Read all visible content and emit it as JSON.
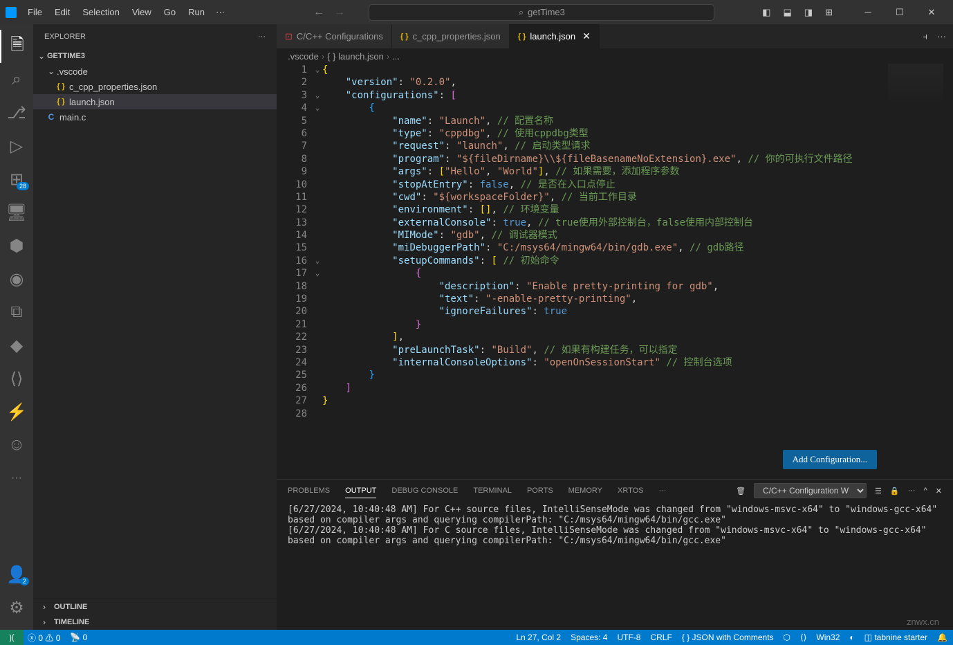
{
  "titlebar": {
    "menus": [
      "File",
      "Edit",
      "Selection",
      "View",
      "Go",
      "Run"
    ],
    "search_placeholder": "getTime3"
  },
  "sidebar": {
    "title": "EXPLORER",
    "project": "GETTIME3",
    "tree": [
      {
        "label": ".vscode",
        "type": "folder",
        "indent": 1
      },
      {
        "label": "c_cpp_properties.json",
        "type": "json",
        "indent": 2
      },
      {
        "label": "launch.json",
        "type": "json",
        "indent": 2,
        "selected": true
      },
      {
        "label": "main.c",
        "type": "c",
        "indent": 1
      }
    ],
    "outline": "OUTLINE",
    "timeline": "TIMELINE"
  },
  "tabs": [
    {
      "label": "C/C++ Configurations",
      "icon": "cpp"
    },
    {
      "label": "c_cpp_properties.json",
      "icon": "json"
    },
    {
      "label": "launch.json",
      "icon": "json",
      "active": true,
      "closable": true
    }
  ],
  "breadcrumb": [
    ".vscode",
    "launch.json",
    "..."
  ],
  "editor": {
    "lines": [
      {
        "n": 1,
        "fold": "v",
        "t": [
          [
            "{",
            "brace"
          ]
        ]
      },
      {
        "n": 2,
        "t": [
          [
            "    ",
            "p"
          ],
          [
            "\"version\"",
            "key"
          ],
          [
            ": ",
            "p"
          ],
          [
            "\"0.2.0\"",
            "str"
          ],
          [
            ",",
            "p"
          ]
        ]
      },
      {
        "n": 3,
        "fold": "v",
        "t": [
          [
            "    ",
            "p"
          ],
          [
            "\"configurations\"",
            "key"
          ],
          [
            ": ",
            "p"
          ],
          [
            "[",
            "brace2"
          ]
        ]
      },
      {
        "n": 4,
        "fold": "v",
        "t": [
          [
            "        ",
            "p"
          ],
          [
            "{",
            "brace3"
          ]
        ]
      },
      {
        "n": 5,
        "t": [
          [
            "            ",
            "p"
          ],
          [
            "\"name\"",
            "key"
          ],
          [
            ": ",
            "p"
          ],
          [
            "\"Launch\"",
            "str"
          ],
          [
            ", ",
            "p"
          ],
          [
            "// 配置名称",
            "comment"
          ]
        ]
      },
      {
        "n": 6,
        "t": [
          [
            "            ",
            "p"
          ],
          [
            "\"type\"",
            "key"
          ],
          [
            ": ",
            "p"
          ],
          [
            "\"cppdbg\"",
            "str"
          ],
          [
            ", ",
            "p"
          ],
          [
            "// 使用cppdbg类型",
            "comment"
          ]
        ]
      },
      {
        "n": 7,
        "t": [
          [
            "            ",
            "p"
          ],
          [
            "\"request\"",
            "key"
          ],
          [
            ": ",
            "p"
          ],
          [
            "\"launch\"",
            "str"
          ],
          [
            ", ",
            "p"
          ],
          [
            "// 启动类型请求",
            "comment"
          ]
        ]
      },
      {
        "n": 8,
        "t": [
          [
            "            ",
            "p"
          ],
          [
            "\"program\"",
            "key"
          ],
          [
            ": ",
            "p"
          ],
          [
            "\"${fileDirname}\\\\${fileBasenameNoExtension}.exe\"",
            "str"
          ],
          [
            ", ",
            "p"
          ],
          [
            "// 你的可执行文件路径",
            "comment"
          ]
        ]
      },
      {
        "n": 9,
        "t": [
          [
            "            ",
            "p"
          ],
          [
            "\"args\"",
            "key"
          ],
          [
            ": ",
            "p"
          ],
          [
            "[",
            "brace"
          ],
          [
            "\"Hello\"",
            "str"
          ],
          [
            ", ",
            "p"
          ],
          [
            "\"World\"",
            "str"
          ],
          [
            "]",
            "brace"
          ],
          [
            ", ",
            "p"
          ],
          [
            "// 如果需要，添加程序参数",
            "comment"
          ]
        ]
      },
      {
        "n": 10,
        "t": [
          [
            "            ",
            "p"
          ],
          [
            "\"stopAtEntry\"",
            "key"
          ],
          [
            ": ",
            "p"
          ],
          [
            "false",
            "bool"
          ],
          [
            ", ",
            "p"
          ],
          [
            "// 是否在入口点停止",
            "comment"
          ]
        ]
      },
      {
        "n": 11,
        "t": [
          [
            "            ",
            "p"
          ],
          [
            "\"cwd\"",
            "key"
          ],
          [
            ": ",
            "p"
          ],
          [
            "\"${workspaceFolder}\"",
            "str"
          ],
          [
            ", ",
            "p"
          ],
          [
            "// 当前工作目录",
            "comment"
          ]
        ]
      },
      {
        "n": 12,
        "t": [
          [
            "            ",
            "p"
          ],
          [
            "\"environment\"",
            "key"
          ],
          [
            ": ",
            "p"
          ],
          [
            "[]",
            "brace"
          ],
          [
            ", ",
            "p"
          ],
          [
            "// 环境变量",
            "comment"
          ]
        ]
      },
      {
        "n": 13,
        "t": [
          [
            "            ",
            "p"
          ],
          [
            "\"externalConsole\"",
            "key"
          ],
          [
            ": ",
            "p"
          ],
          [
            "true",
            "bool"
          ],
          [
            ", ",
            "p"
          ],
          [
            "// true使用外部控制台，false使用内部控制台",
            "comment"
          ]
        ]
      },
      {
        "n": 14,
        "t": [
          [
            "            ",
            "p"
          ],
          [
            "\"MIMode\"",
            "key"
          ],
          [
            ": ",
            "p"
          ],
          [
            "\"gdb\"",
            "str"
          ],
          [
            ", ",
            "p"
          ],
          [
            "// 调试器模式",
            "comment"
          ]
        ]
      },
      {
        "n": 15,
        "t": [
          [
            "            ",
            "p"
          ],
          [
            "\"miDebuggerPath\"",
            "key"
          ],
          [
            ": ",
            "p"
          ],
          [
            "\"C:/msys64/mingw64/bin/gdb.exe\"",
            "str"
          ],
          [
            ", ",
            "p"
          ],
          [
            "// gdb路径",
            "comment"
          ]
        ]
      },
      {
        "n": 16,
        "fold": "v",
        "t": [
          [
            "            ",
            "p"
          ],
          [
            "\"setupCommands\"",
            "key"
          ],
          [
            ": ",
            "p"
          ],
          [
            "[ ",
            "brace"
          ],
          [
            "// 初始命令",
            "comment"
          ]
        ]
      },
      {
        "n": 17,
        "fold": "v",
        "t": [
          [
            "                ",
            "p"
          ],
          [
            "{",
            "brace2"
          ]
        ]
      },
      {
        "n": 18,
        "t": [
          [
            "                    ",
            "p"
          ],
          [
            "\"description\"",
            "key"
          ],
          [
            ": ",
            "p"
          ],
          [
            "\"Enable pretty-printing for gdb\"",
            "str"
          ],
          [
            ",",
            "p"
          ]
        ]
      },
      {
        "n": 19,
        "t": [
          [
            "                    ",
            "p"
          ],
          [
            "\"text\"",
            "key"
          ],
          [
            ": ",
            "p"
          ],
          [
            "\"-enable-pretty-printing\"",
            "str"
          ],
          [
            ",",
            "p"
          ]
        ]
      },
      {
        "n": 20,
        "t": [
          [
            "                    ",
            "p"
          ],
          [
            "\"ignoreFailures\"",
            "key"
          ],
          [
            ": ",
            "p"
          ],
          [
            "true",
            "bool"
          ]
        ]
      },
      {
        "n": 21,
        "t": [
          [
            "                ",
            "p"
          ],
          [
            "}",
            "brace2"
          ]
        ]
      },
      {
        "n": 22,
        "t": [
          [
            "            ",
            "p"
          ],
          [
            "]",
            "brace"
          ],
          [
            ",",
            "p"
          ]
        ]
      },
      {
        "n": 23,
        "t": [
          [
            "            ",
            "p"
          ],
          [
            "\"preLaunchTask\"",
            "key"
          ],
          [
            ": ",
            "p"
          ],
          [
            "\"Build\"",
            "str"
          ],
          [
            ", ",
            "p"
          ],
          [
            "// 如果有构建任务，可以指定",
            "comment"
          ]
        ]
      },
      {
        "n": 24,
        "t": [
          [
            "            ",
            "p"
          ],
          [
            "\"internalConsoleOptions\"",
            "key"
          ],
          [
            ": ",
            "p"
          ],
          [
            "\"openOnSessionStart\"",
            "str"
          ],
          [
            " ",
            "p"
          ],
          [
            "// 控制台选项",
            "comment"
          ]
        ]
      },
      {
        "n": 25,
        "t": [
          [
            "        ",
            "p"
          ],
          [
            "}",
            "brace3"
          ]
        ]
      },
      {
        "n": 26,
        "t": [
          [
            "    ",
            "p"
          ],
          [
            "]",
            "brace2"
          ]
        ]
      },
      {
        "n": 27,
        "t": [
          [
            "}",
            "brace"
          ]
        ]
      },
      {
        "n": 28,
        "t": []
      }
    ],
    "add_config": "Add Configuration..."
  },
  "panel": {
    "tabs": [
      "PROBLEMS",
      "OUTPUT",
      "DEBUG CONSOLE",
      "TERMINAL",
      "PORTS",
      "MEMORY",
      "XRTOS"
    ],
    "active": "OUTPUT",
    "select": "C/C++ Configuration W",
    "output": "[6/27/2024, 10:40:48 AM] For C++ source files, IntelliSenseMode was changed from \"windows-msvc-x64\" to \"windows-gcc-x64\" based on compiler args and querying compilerPath: \"C:/msys64/mingw64/bin/gcc.exe\"\n[6/27/2024, 10:40:48 AM] For C source files, IntelliSenseMode was changed from \"windows-msvc-x64\" to \"windows-gcc-x64\" based on compiler args and querying compilerPath: \"C:/msys64/mingw64/bin/gcc.exe\""
  },
  "statusbar": {
    "errors": "0",
    "warnings": "0",
    "ports": "0",
    "cursor": "Ln 27, Col 2",
    "spaces": "Spaces: 4",
    "encoding": "UTF-8",
    "eol": "CRLF",
    "lang": "JSON with Comments",
    "platform": "Win32",
    "tabnine": "tabnine starter"
  },
  "activity_badge": "28",
  "accounts_badge": "2",
  "watermark": "znwx.cn"
}
